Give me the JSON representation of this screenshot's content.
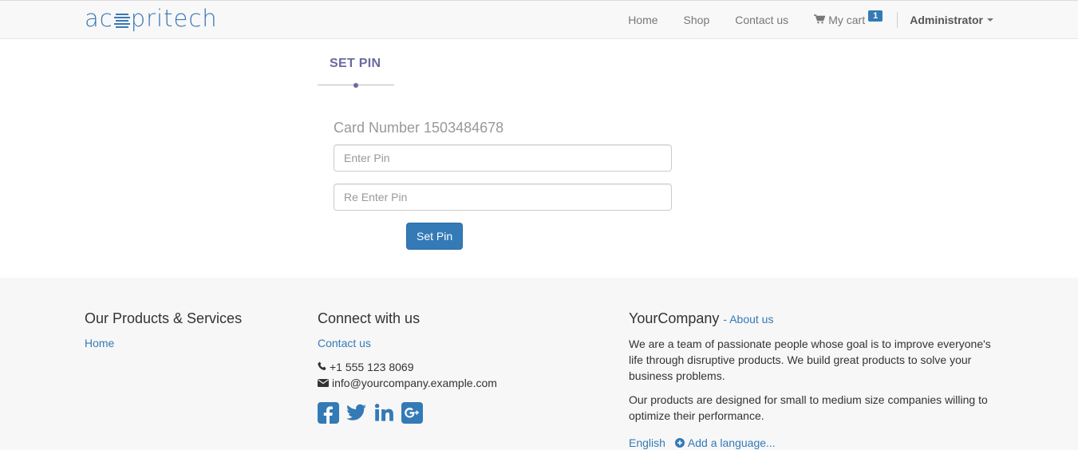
{
  "brand": {
    "name": "acspritech",
    "prefix": "ac",
    "suffix": "pritech"
  },
  "nav": {
    "items": [
      {
        "label": "Home"
      },
      {
        "label": "Shop"
      },
      {
        "label": "Contact us"
      }
    ],
    "cart_label": "My cart",
    "cart_count": "1",
    "user": "Administrator"
  },
  "form": {
    "title": "SET PIN",
    "card_label": "Card Number 1503484678",
    "pin_placeholder": "Enter Pin",
    "repin_placeholder": "Re Enter Pin",
    "submit": "Set Pin"
  },
  "footer": {
    "products": {
      "title": "Our Products & Services",
      "home": "Home"
    },
    "connect": {
      "title": "Connect with us",
      "contact": "Contact us",
      "phone": "+1 555 123 8069",
      "email": "info@yourcompany.example.com"
    },
    "company": {
      "name": "YourCompany",
      "about_prefix": "- ",
      "about": "About us",
      "p1": "We are a team of passionate people whose goal is to improve everyone's life through disruptive products. We build great products to solve your business problems.",
      "p2": "Our products are designed for small to medium size companies willing to optimize their performance.",
      "lang": "English",
      "add_lang": "Add a language..."
    }
  },
  "colors": {
    "primary": "#337ab7",
    "accent": "#6a6a9e",
    "footer_bg": "#f7f7f7",
    "navbar_bg": "#f8f8f8"
  }
}
